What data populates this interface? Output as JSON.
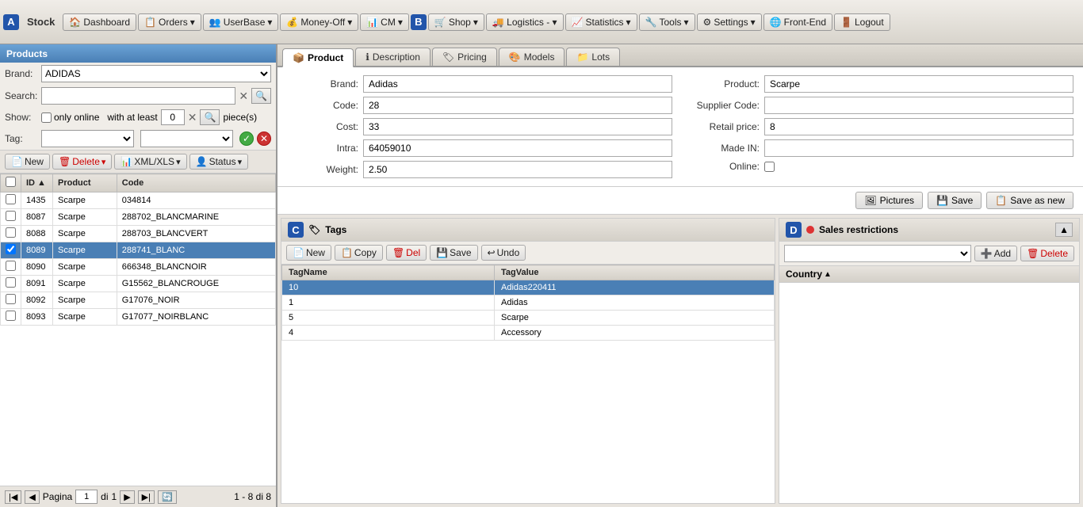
{
  "topbar": {
    "stock_label": "Stock",
    "buttons": [
      {
        "label": "Dashboard",
        "icon": "🏠"
      },
      {
        "label": "Orders",
        "icon": "📋",
        "dropdown": true
      },
      {
        "label": "UserBase",
        "icon": "👥",
        "dropdown": true
      },
      {
        "label": "Money-Off",
        "icon": "💰",
        "dropdown": true
      },
      {
        "label": "CM",
        "icon": "📊",
        "dropdown": true
      },
      {
        "label": "Shop",
        "icon": "🛒",
        "dropdown": true
      },
      {
        "label": "Logistics",
        "icon": "🚚",
        "dropdown": true
      },
      {
        "label": "Statistics",
        "icon": "📈",
        "dropdown": true
      },
      {
        "label": "Tools",
        "icon": "🔧",
        "dropdown": true
      },
      {
        "label": "Settings",
        "icon": "⚙",
        "dropdown": true
      },
      {
        "label": "Front-End",
        "icon": "🌐"
      },
      {
        "label": "Logout",
        "icon": "🚪"
      }
    ]
  },
  "left": {
    "title": "Products",
    "brand_label": "Brand:",
    "brand_value": "ADIDAS",
    "search_label": "Search:",
    "search_placeholder": "",
    "show_label": "Show:",
    "only_online_label": "only online",
    "with_at_least_label": "with at least",
    "pieces_label": "piece(s)",
    "min_pieces": "0",
    "tag_label": "Tag:",
    "new_btn": "New",
    "delete_btn": "Delete",
    "xml_btn": "XML/XLS",
    "status_btn": "Status",
    "columns": [
      {
        "key": "id",
        "label": "ID"
      },
      {
        "key": "product",
        "label": "Product"
      },
      {
        "key": "code",
        "label": "Code"
      }
    ],
    "rows": [
      {
        "id": "1435",
        "product": "Scarpe",
        "code": "034814",
        "selected": false
      },
      {
        "id": "8087",
        "product": "Scarpe",
        "code": "288702_BLANCMARINE",
        "selected": false
      },
      {
        "id": "8088",
        "product": "Scarpe",
        "code": "288703_BLANCVERT",
        "selected": false
      },
      {
        "id": "8089",
        "product": "Scarpe",
        "code": "288741_BLANC",
        "selected": true
      },
      {
        "id": "8090",
        "product": "Scarpe",
        "code": "666348_BLANCNOIR",
        "selected": false
      },
      {
        "id": "8091",
        "product": "Scarpe",
        "code": "G15562_BLANCROUGE",
        "selected": false
      },
      {
        "id": "8092",
        "product": "Scarpe",
        "code": "G17076_NOIR",
        "selected": false
      },
      {
        "id": "8093",
        "product": "Scarpe",
        "code": "G17077_NOIRBLANC",
        "selected": false
      }
    ],
    "pagination": {
      "page_label": "Pagina",
      "page": "1",
      "of_label": "di",
      "total_pages": "1",
      "count_label": "1 - 8 di 8"
    }
  },
  "right": {
    "tabs": [
      {
        "label": "Product",
        "icon": "📦",
        "active": true
      },
      {
        "label": "Description",
        "icon": "ℹ"
      },
      {
        "label": "Pricing",
        "icon": "🏷"
      },
      {
        "label": "Models",
        "icon": "🎨"
      },
      {
        "label": "Lots",
        "icon": "📁"
      }
    ],
    "form": {
      "brand_label": "Brand:",
      "brand_value": "Adidas",
      "code_label": "Code:",
      "code_value": "28",
      "cost_label": "Cost:",
      "cost_value": "33",
      "intra_label": "Intra:",
      "intra_value": "64059010",
      "weight_label": "Weight:",
      "weight_value": "2.50",
      "product_label": "Product:",
      "product_value": "Scarpe",
      "supplier_code_label": "Supplier Code:",
      "supplier_code_value": "",
      "retail_price_label": "Retail price:",
      "retail_price_value": "8",
      "made_in_label": "Made IN:",
      "made_in_value": "",
      "online_label": "Online:"
    },
    "actions": {
      "pictures_btn": "Pictures",
      "save_btn": "Save",
      "save_as_new_btn": "Save as new"
    },
    "tags": {
      "title": "Tags",
      "new_btn": "New",
      "copy_btn": "Copy",
      "del_btn": "Del",
      "save_btn": "Save",
      "undo_btn": "Undo",
      "col_tagname": "TagName",
      "col_tagvalue": "TagValue",
      "rows": [
        {
          "tagname": "10",
          "tagvalue": "Adidas220411",
          "selected": true
        },
        {
          "tagname": "1",
          "tagvalue": "Adidas"
        },
        {
          "tagname": "5",
          "tagvalue": "Scarpe"
        },
        {
          "tagname": "4",
          "tagvalue": "Accessory"
        }
      ]
    },
    "sales": {
      "title": "Sales restrictions",
      "add_btn": "Add",
      "delete_btn": "Delete",
      "col_country": "Country"
    }
  }
}
